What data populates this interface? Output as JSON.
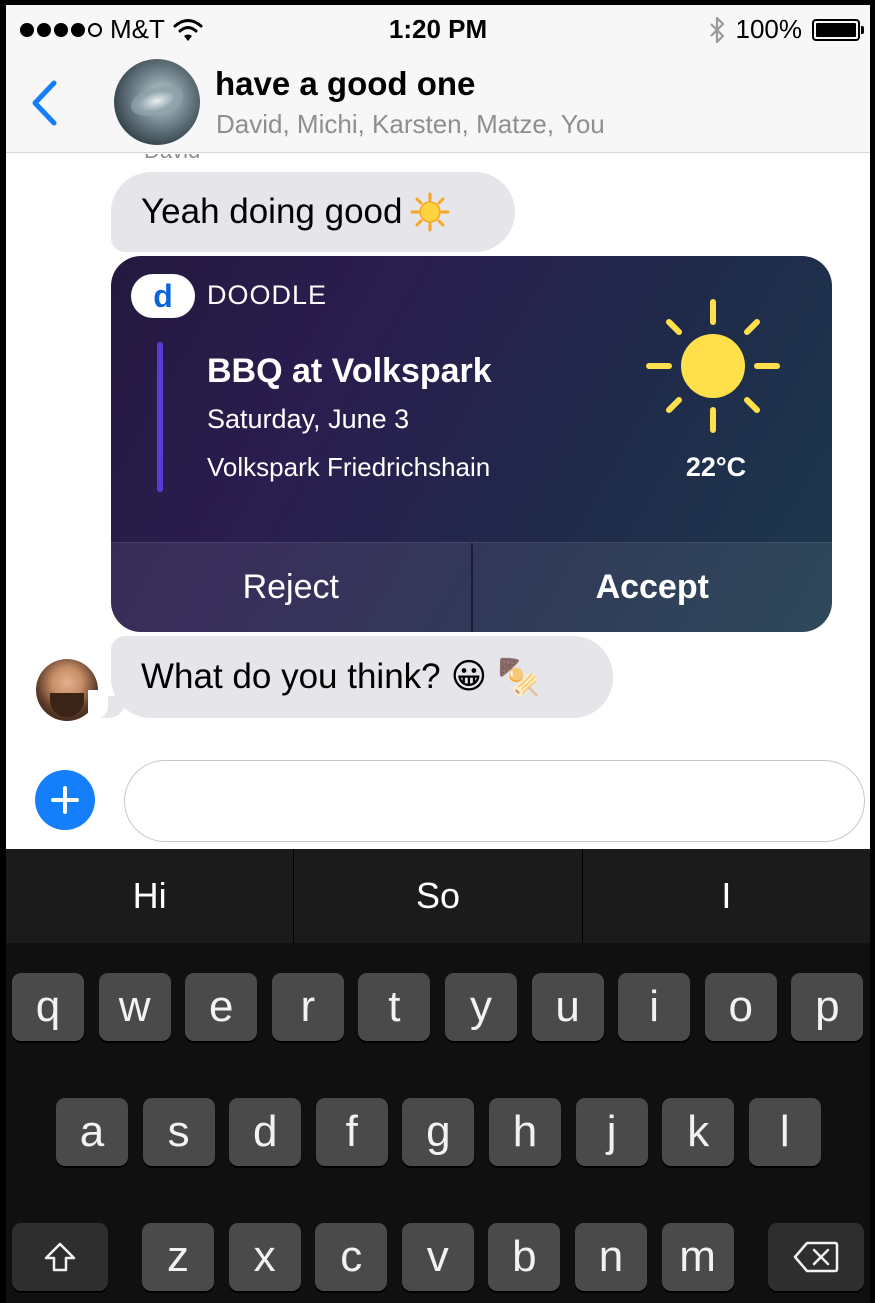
{
  "status_bar": {
    "carrier": "M&T",
    "time": "1:20 PM",
    "battery": "100%",
    "battery_level": 1.0
  },
  "header": {
    "back_icon": "chevron-left-icon",
    "title": "have a good one",
    "members": "David, Michi, Karsten, Matze, You"
  },
  "messages": {
    "sender_name": "David",
    "message_1": "Yeah doing good",
    "message_3": "What do you think?",
    "message_3_emoji": "😀",
    "message_3_emoji_2": "🍢"
  },
  "doodle_card": {
    "badge": "d",
    "brand": "DOODLE",
    "event_title": "BBQ at Volkspark",
    "event_date": "Saturday, June 3",
    "event_location": "Volkspark Friedrichshain",
    "temperature": "22°C",
    "reject_label": "Reject",
    "accept_label": "Accept"
  },
  "composer": {
    "text": "",
    "placeholder": ""
  },
  "keyboard": {
    "suggestions": [
      "Hi",
      "So",
      "I"
    ],
    "row1": [
      "q",
      "w",
      "e",
      "r",
      "t",
      "y",
      "u",
      "i",
      "o",
      "p"
    ],
    "row2": [
      "a",
      "s",
      "d",
      "f",
      "g",
      "h",
      "j",
      "k",
      "l"
    ],
    "row3": [
      "z",
      "x",
      "c",
      "v",
      "b",
      "n",
      "m"
    ]
  },
  "colors": {
    "accent": "#147efb",
    "bubble_gray": "#e5e5ea",
    "card_purple": "#2a1d4f",
    "sun_yellow": "#ffe04a"
  }
}
